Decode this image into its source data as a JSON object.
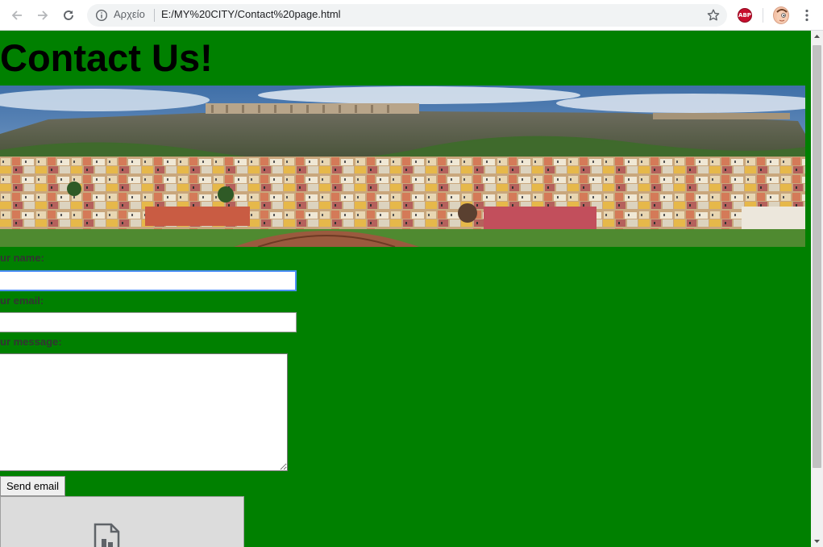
{
  "browser": {
    "back_icon": "arrow-left-icon",
    "forward_icon": "arrow-right-icon",
    "reload_icon": "reload-icon",
    "site_info_icon": "info-icon",
    "site_chip": "Αρχείο",
    "url": "E:/MY%20CITY/Contact%20page.html",
    "bookmark_icon": "star-icon",
    "extension_label": "ABP",
    "avatar_icon": "profile-avatar-icon",
    "menu_icon": "kebab-menu-icon"
  },
  "page": {
    "background_color": "#008000",
    "title": "Contact Us!",
    "hero_image": "athens-city-panorama",
    "form": {
      "name_label": "ur name:",
      "name_value": "",
      "email_label": "ur email:",
      "email_value": "",
      "message_label": "ur message:",
      "message_value": "",
      "submit_label": "Send email"
    },
    "embed_icon": "broken-file-icon"
  },
  "scrollbar": {
    "up_icon": "scroll-up-arrow-icon",
    "down_icon": "scroll-down-arrow-icon"
  }
}
